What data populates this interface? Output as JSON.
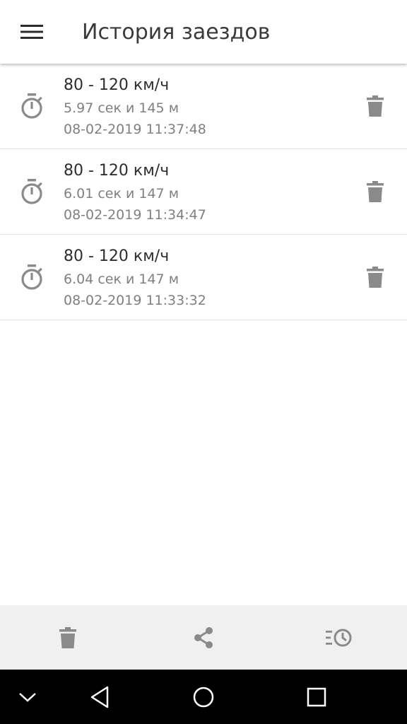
{
  "app_bar": {
    "title": "История заездов",
    "menu_icon": "hamburger-menu-icon"
  },
  "runs": [
    {
      "title": "80 - 120 км/ч",
      "result": "5.97 сек и 145 м",
      "date": "08-02-2019 11:37:48"
    },
    {
      "title": "80 - 120 км/ч",
      "result": "6.01 сек и 147 м",
      "date": "08-02-2019 11:34:47"
    },
    {
      "title": "80 - 120 км/ч",
      "result": "6.04 сек и 147 м",
      "date": "08-02-2019 11:33:32"
    }
  ],
  "toolbar": {
    "icons": [
      "trash-icon",
      "share-icon",
      "history-icon"
    ]
  },
  "system_nav": {
    "icons": [
      "chevron-down-icon",
      "back-icon",
      "home-icon",
      "recents-icon"
    ]
  },
  "colors": {
    "icon_gray": "#8a8a8a",
    "title_text": "#3a3a3a",
    "secondary_text": "#808080",
    "toolbar_bg": "#f0f0f0",
    "navbar_bg": "#000000"
  }
}
